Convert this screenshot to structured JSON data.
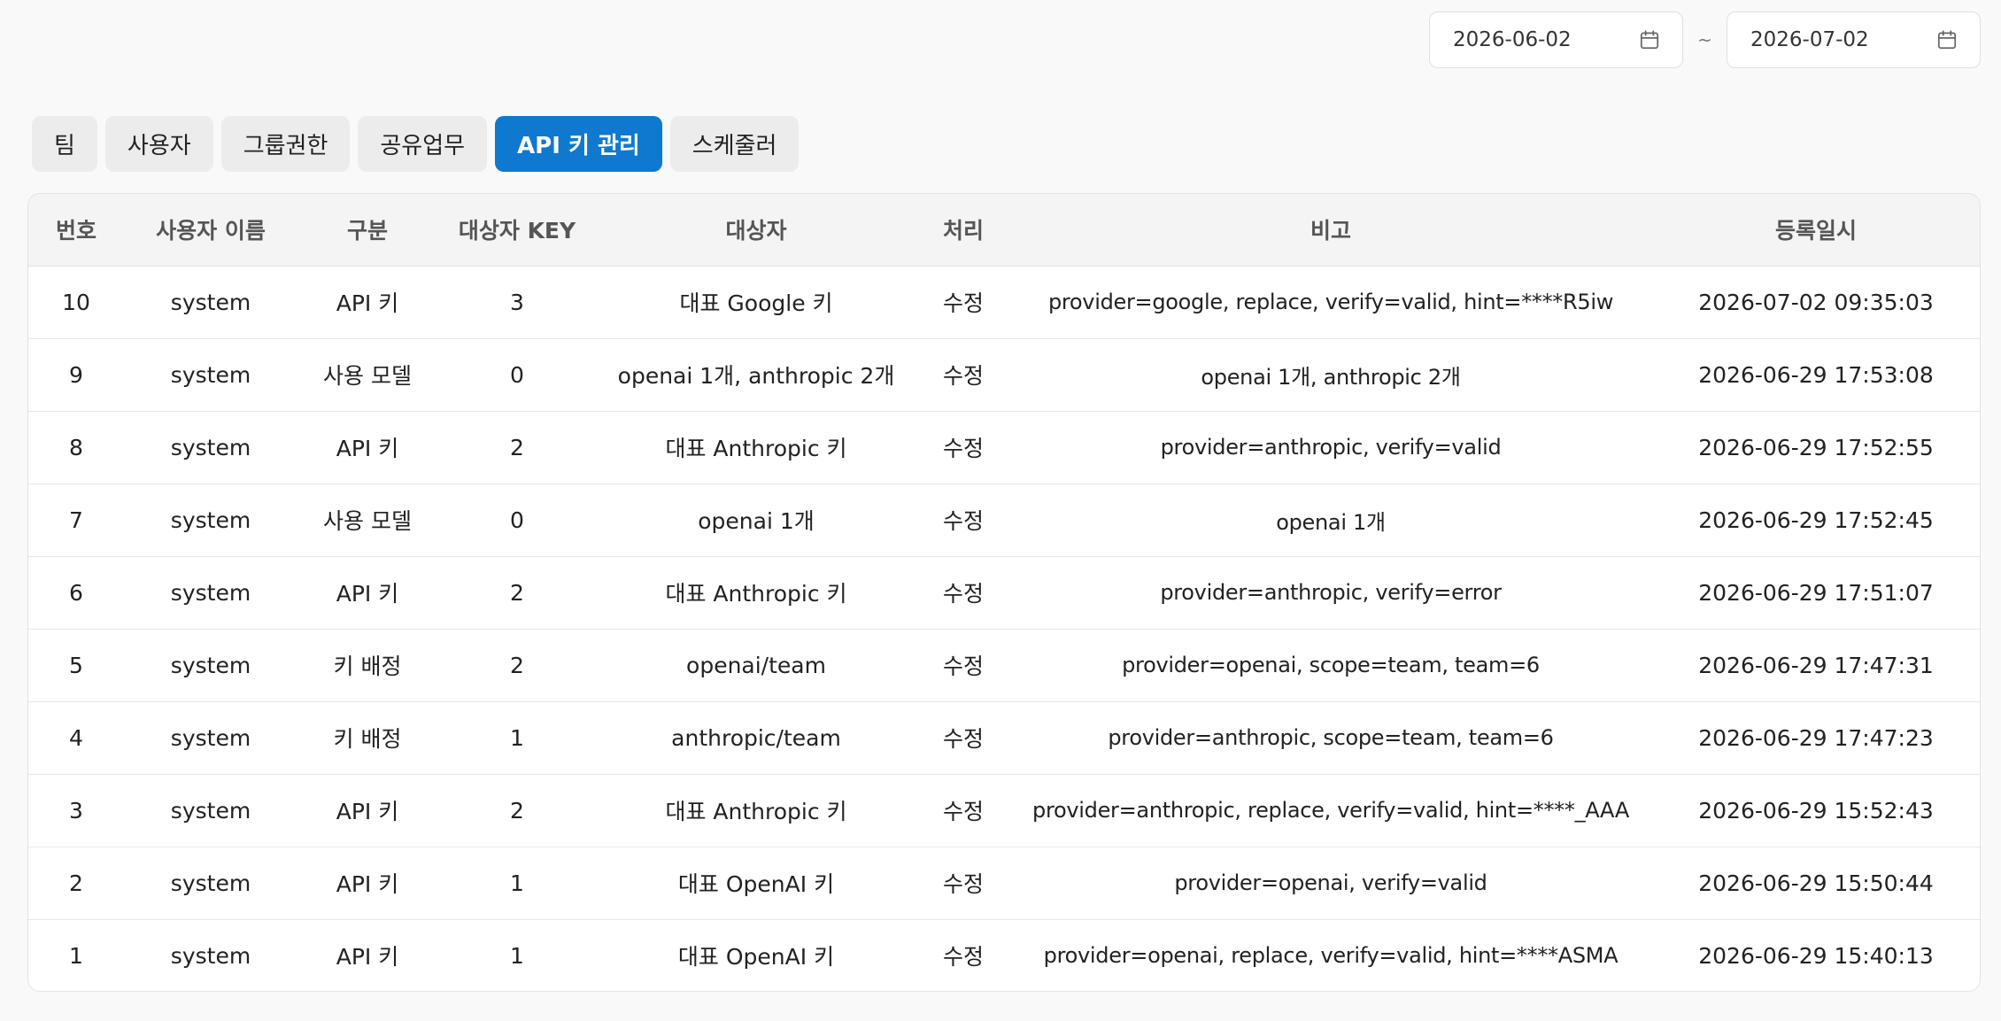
{
  "date_range": {
    "start": "2026-06-02",
    "separator": "~",
    "end": "2026-07-02",
    "icon": "calendar-icon"
  },
  "tabs": [
    {
      "label": "팀",
      "active": false
    },
    {
      "label": "사용자",
      "active": false
    },
    {
      "label": "그룹권한",
      "active": false
    },
    {
      "label": "공유업무",
      "active": false
    },
    {
      "label": "API 키 관리",
      "active": true
    },
    {
      "label": "스케줄러",
      "active": false
    }
  ],
  "colors": {
    "accent": "#0e79cf",
    "tab_bg": "#ececec",
    "header_bg": "#f4f4f4"
  },
  "table": {
    "headers": [
      "번호",
      "사용자 이름",
      "구분",
      "대상자 KEY",
      "대상자",
      "처리",
      "비고",
      "등록일시"
    ],
    "rows": [
      [
        "10",
        "system",
        "API 키",
        "3",
        "대표 Google 키",
        "수정",
        "provider=google, replace, verify=valid, hint=****R5iw",
        "2026-07-02 09:35:03"
      ],
      [
        "9",
        "system",
        "사용 모델",
        "0",
        "openai 1개, anthropic 2개",
        "수정",
        "openai 1개, anthropic 2개",
        "2026-06-29 17:53:08"
      ],
      [
        "8",
        "system",
        "API 키",
        "2",
        "대표 Anthropic 키",
        "수정",
        "provider=anthropic, verify=valid",
        "2026-06-29 17:52:55"
      ],
      [
        "7",
        "system",
        "사용 모델",
        "0",
        "openai 1개",
        "수정",
        "openai 1개",
        "2026-06-29 17:52:45"
      ],
      [
        "6",
        "system",
        "API 키",
        "2",
        "대표 Anthropic 키",
        "수정",
        "provider=anthropic, verify=error",
        "2026-06-29 17:51:07"
      ],
      [
        "5",
        "system",
        "키 배정",
        "2",
        "openai/team",
        "수정",
        "provider=openai, scope=team, team=6",
        "2026-06-29 17:47:31"
      ],
      [
        "4",
        "system",
        "키 배정",
        "1",
        "anthropic/team",
        "수정",
        "provider=anthropic, scope=team, team=6",
        "2026-06-29 17:47:23"
      ],
      [
        "3",
        "system",
        "API 키",
        "2",
        "대표 Anthropic 키",
        "수정",
        "provider=anthropic, replace, verify=valid, hint=****_AAA",
        "2026-06-29 15:52:43"
      ],
      [
        "2",
        "system",
        "API 키",
        "1",
        "대표 OpenAI 키",
        "수정",
        "provider=openai, verify=valid",
        "2026-06-29 15:50:44"
      ],
      [
        "1",
        "system",
        "API 키",
        "1",
        "대표 OpenAI 키",
        "수정",
        "provider=openai, replace, verify=valid, hint=****ASMA",
        "2026-06-29 15:40:13"
      ]
    ]
  }
}
